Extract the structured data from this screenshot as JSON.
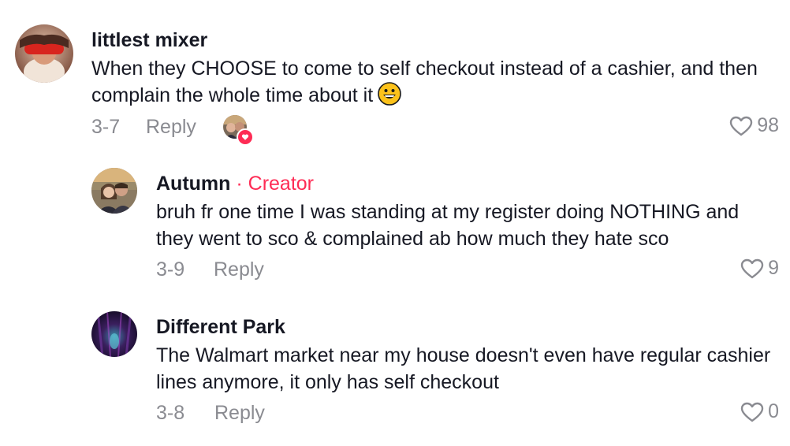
{
  "comments": [
    {
      "username": "littlest mixer",
      "text": "When they CHOOSE to come to self checkout instead of a cashier, and then complain the whole time about it",
      "emoji": "grinning-face-emoji",
      "date": "3-7",
      "reply_label": "Reply",
      "likes": "98",
      "liked_by_creator": true
    },
    {
      "username": "Autumn",
      "badge": "· Creator",
      "text": "bruh fr one time I was standing at my register doing NOTHING and they went to sco & complained ab how much they hate sco",
      "date": "3-9",
      "reply_label": "Reply",
      "likes": "9"
    },
    {
      "username": "Different Park",
      "text": "The Walmart market near my house doesn't even have regular cashier lines anymore, it only has self checkout",
      "date": "3-8",
      "reply_label": "Reply",
      "likes": "0"
    }
  ],
  "colors": {
    "creator": "#fe2c55",
    "muted": "#8a8b91",
    "text": "#161823"
  }
}
